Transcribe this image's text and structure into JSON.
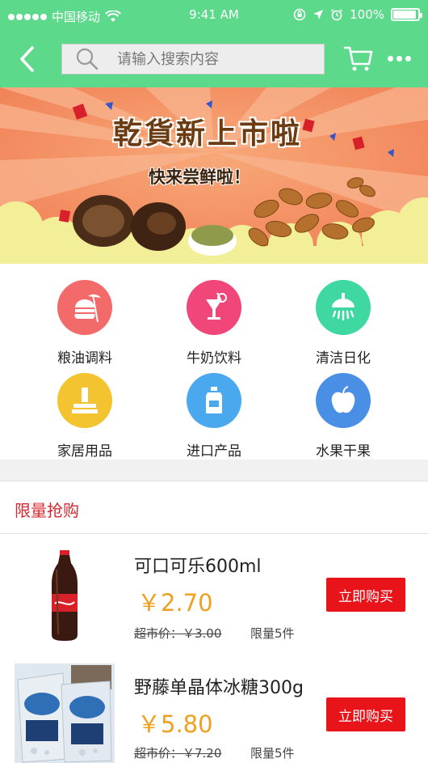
{
  "status_bar": {
    "carrier": "中国移动",
    "time": "9:41 AM",
    "battery": "100%",
    "battery_level": 1.0
  },
  "nav": {
    "search_placeholder": "请输入搜索内容"
  },
  "banner": {
    "title": "乾貨新上市啦",
    "subtitle": "快来尝鲜啦！"
  },
  "categories": [
    {
      "label": "粮油调料",
      "icon": "grain-oil-icon",
      "color": "#f26a6a"
    },
    {
      "label": "牛奶饮料",
      "icon": "drink-icon",
      "color": "#f0467a"
    },
    {
      "label": "清洁日化",
      "icon": "shower-icon",
      "color": "#3ed8a0"
    },
    {
      "label": "家居用品",
      "icon": "household-icon",
      "color": "#f4c430"
    },
    {
      "label": "进口产品",
      "icon": "bottle-icon",
      "color": "#4aa9ee"
    },
    {
      "label": "水果干果",
      "icon": "apple-icon",
      "color": "#4a8fe6"
    }
  ],
  "flash_sale": {
    "title": "限量抢购"
  },
  "products": [
    {
      "name": "可口可乐600ml",
      "price": "￥2.70",
      "original_price": "超市价：￥3.00",
      "limit": "限量5件",
      "buy_label": "立即购买"
    },
    {
      "name": "野藤单晶体冰糖300g",
      "price": "￥5.80",
      "original_price": "超市价：￥7.20",
      "limit": "限量5件",
      "buy_label": "立即购买"
    }
  ],
  "colors": {
    "brand_green": "#5cd98a",
    "accent_red": "#e8141a",
    "price_orange": "#f0a020"
  }
}
